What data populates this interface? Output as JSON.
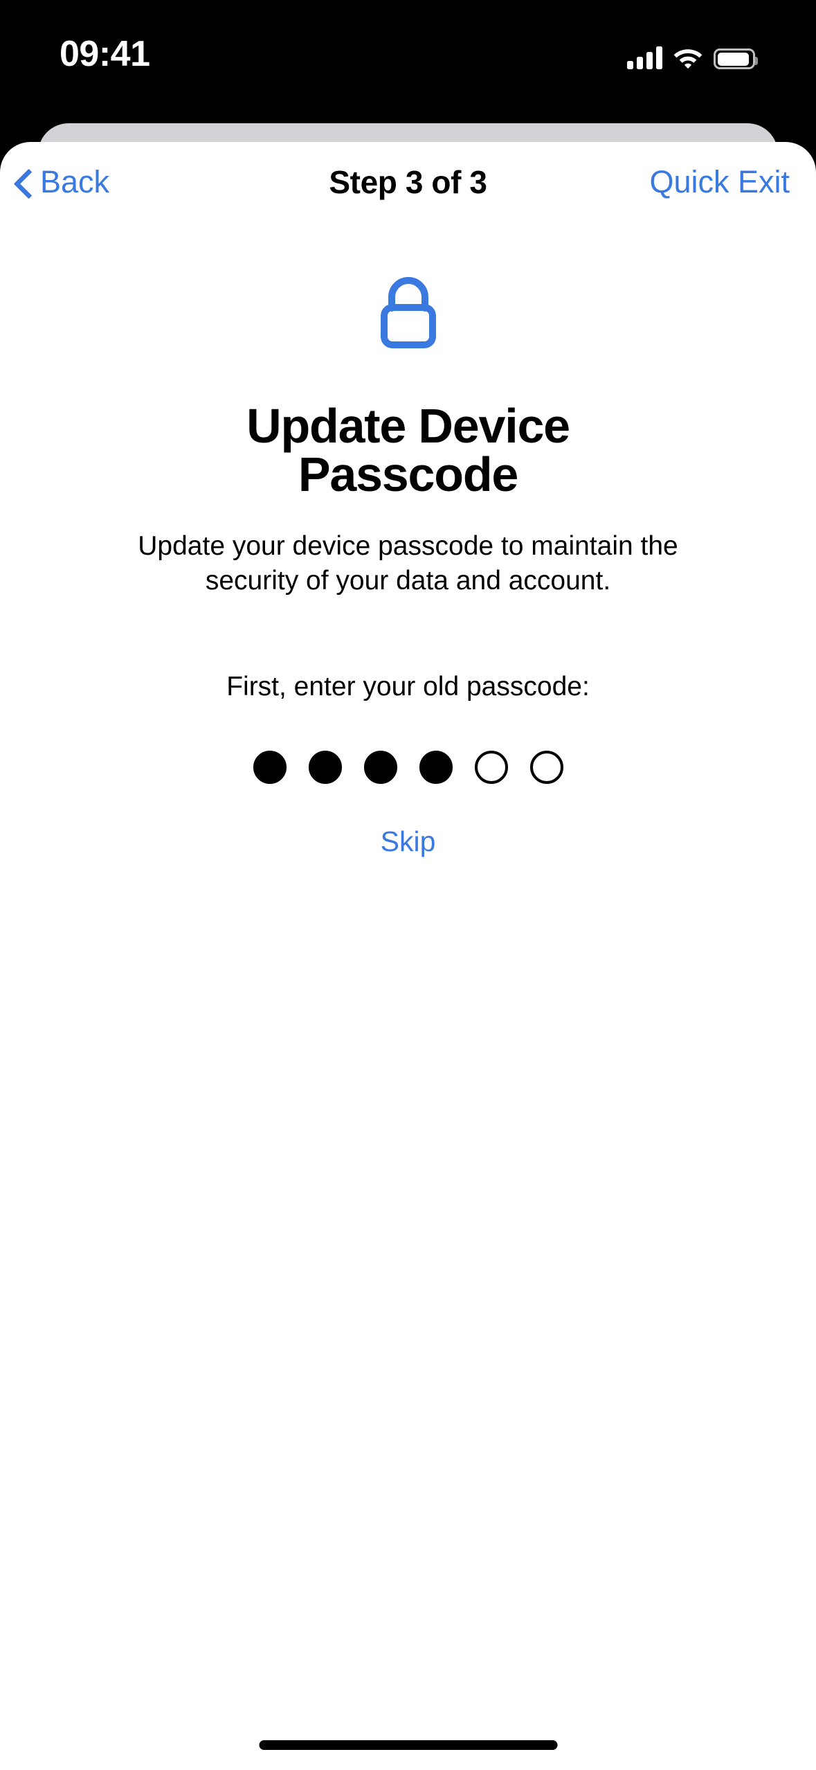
{
  "status_bar": {
    "time": "09:41",
    "cellular_icon": "cellular-signal-icon",
    "cellular_bars": 4,
    "wifi_icon": "wifi-icon",
    "battery_icon": "battery-icon",
    "battery_level_percent": 93
  },
  "nav": {
    "back_label": "Back",
    "back_icon": "chevron-left-icon",
    "title": "Step 3 of 3",
    "quick_exit_label": "Quick Exit"
  },
  "hero": {
    "icon": "lock-icon",
    "icon_color": "#3a7ae0"
  },
  "main": {
    "title": "Update Device Passcode",
    "subtitle": "Update your device passcode to maintain the security of your data and account.",
    "prompt": "First, enter your old passcode:",
    "skip_label": "Skip"
  },
  "passcode": {
    "length": 6,
    "entered_count": 4,
    "dots": [
      {
        "filled": true
      },
      {
        "filled": true
      },
      {
        "filled": true
      },
      {
        "filled": true
      },
      {
        "filled": false
      },
      {
        "filled": false
      }
    ]
  },
  "colors": {
    "accent_blue": "#3a7ae0",
    "sheet_background": "#ffffff",
    "behind_card": "#d2d2d7",
    "device_background": "#000000",
    "text_primary": "#000000"
  },
  "system": {
    "home_indicator": "home-indicator"
  }
}
